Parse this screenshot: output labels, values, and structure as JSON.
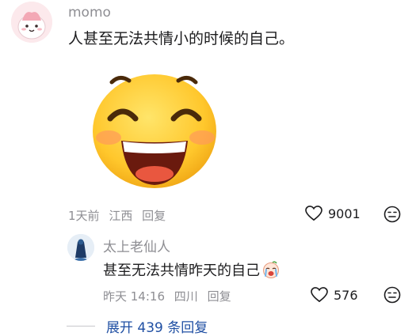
{
  "comment": {
    "username": "momo",
    "text": "人甚至无法共情小的时候的自己。",
    "meta": {
      "time": "1天前",
      "location": "江西",
      "reply_label": "回复"
    },
    "likes": "9001"
  },
  "reply": {
    "username": "太上老仙人",
    "text": "甚至无法共情昨天的自己",
    "meta": {
      "time": "昨天 14:16",
      "location": "四川",
      "reply_label": "回复"
    },
    "likes": "576"
  },
  "expand": {
    "label": "展开 439 条回复"
  },
  "colors": {
    "accent": "#1f4fa3",
    "muted": "#8e8e93",
    "text": "#1c1c1e"
  },
  "icons": [
    "avatar-character",
    "laughing-emoji-sticker",
    "heart-icon",
    "dislike-face-icon",
    "crying-emoji-icon"
  ]
}
